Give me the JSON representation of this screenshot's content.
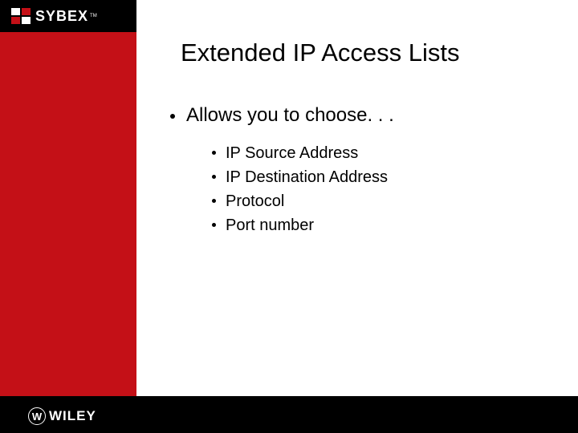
{
  "brand_top": "SYBEX",
  "brand_bottom": "WILEY",
  "title": "Extended IP Access Lists",
  "main_bullet": "Allows you to choose. . .",
  "sub_bullets": [
    "IP Source Address",
    "IP Destination Address",
    "Protocol",
    "Port number"
  ]
}
